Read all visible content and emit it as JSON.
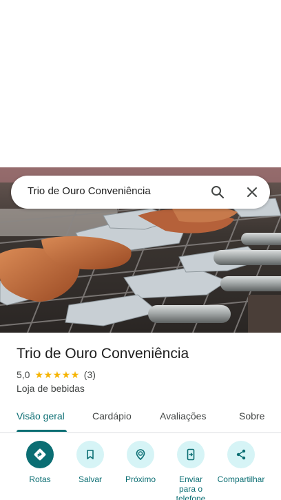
{
  "search": {
    "query": "Trio de Ouro Conveniência"
  },
  "place": {
    "name": "Trio de Ouro Conveniência",
    "rating": "5,0",
    "stars": 5,
    "review_count": "(3)",
    "category": "Loja de bebidas"
  },
  "tabs": [
    {
      "label": "Visão geral",
      "active": true
    },
    {
      "label": "Cardápio",
      "active": false
    },
    {
      "label": "Avaliações",
      "active": false
    },
    {
      "label": "Sobre",
      "active": false
    }
  ],
  "actions": [
    {
      "label": "Rotas",
      "icon": "directions-icon"
    },
    {
      "label": "Salvar",
      "icon": "bookmark-icon"
    },
    {
      "label": "Próximo",
      "icon": "nearby-icon"
    },
    {
      "label": "Enviar para o telefone",
      "icon": "send-to-phone-icon"
    },
    {
      "label": "Compartilhar",
      "icon": "share-icon"
    }
  ],
  "colors": {
    "accent": "#0b6e73",
    "action_bg": "#d6f4f6",
    "star": "#f6b400"
  }
}
